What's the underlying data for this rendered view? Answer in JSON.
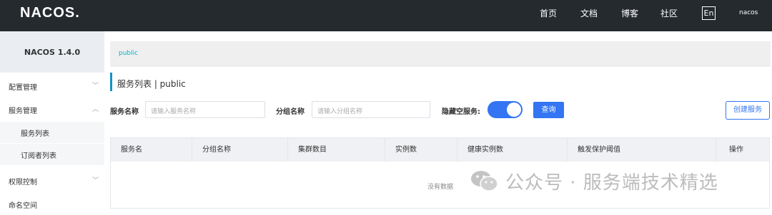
{
  "topbar": {
    "logo": "NACOS.",
    "nav": [
      "首页",
      "文档",
      "博客",
      "社区"
    ],
    "lang": "En",
    "user": "nacos"
  },
  "sidebar": {
    "version": "NACOS 1.4.0",
    "items": [
      {
        "label": "配置管理"
      },
      {
        "label": "服务管理"
      },
      {
        "label": "服务列表"
      },
      {
        "label": "订阅者列表"
      },
      {
        "label": "权限控制"
      },
      {
        "label": "命名空间"
      }
    ]
  },
  "breadcrumb": "public",
  "page_title": "服务列表  |  public",
  "filters": {
    "service_name_label": "服务名称",
    "service_name_placeholder": "请输入服务名称",
    "group_name_label": "分组名称",
    "group_name_placeholder": "请输入分组名称",
    "hide_empty_label": "隐藏空服务:",
    "hide_empty_on": true,
    "query_label": "查询",
    "create_label": "创建服务"
  },
  "table": {
    "columns": [
      "服务名",
      "分组名称",
      "集群数目",
      "实例数",
      "健康实例数",
      "触发保护阈值",
      "操作"
    ],
    "empty_text": "没有数据"
  },
  "watermark": "公众号 · 服务端技术精选",
  "colors": {
    "topbar": "#252a2f",
    "accent": "#3375f2",
    "link": "#00b5cf"
  }
}
